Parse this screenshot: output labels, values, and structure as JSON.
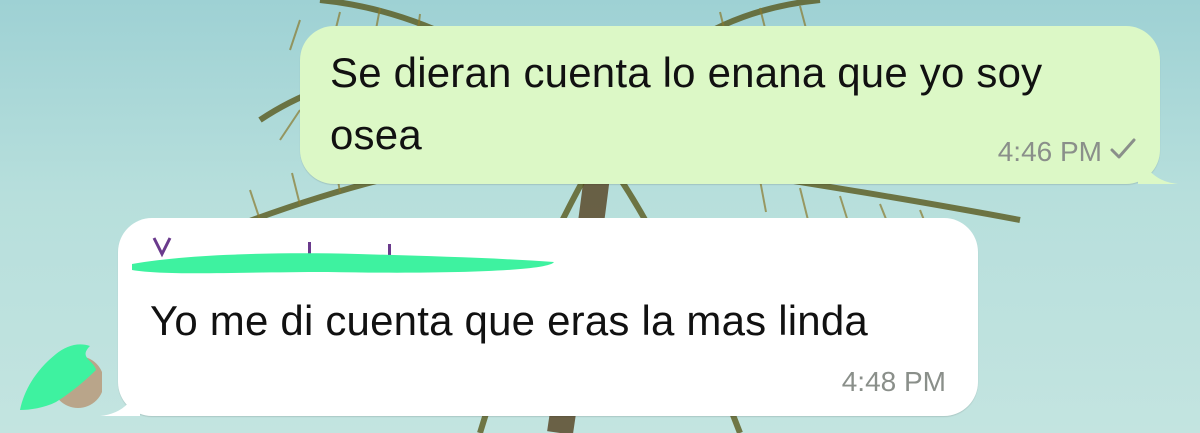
{
  "messages": {
    "outgoing": {
      "text": "Se dieran cuenta lo enana que yo soy osea",
      "time": "4:46 PM",
      "status_icon": "single-check-icon"
    },
    "incoming": {
      "text": "Yo me di cuenta que eras la mas linda",
      "time": "4:48 PM"
    }
  },
  "colors": {
    "outgoing_bubble": "#dcf8c6",
    "incoming_bubble": "#ffffff",
    "redaction": "#3ef2a0",
    "sender_name": "#6a3a8c"
  }
}
